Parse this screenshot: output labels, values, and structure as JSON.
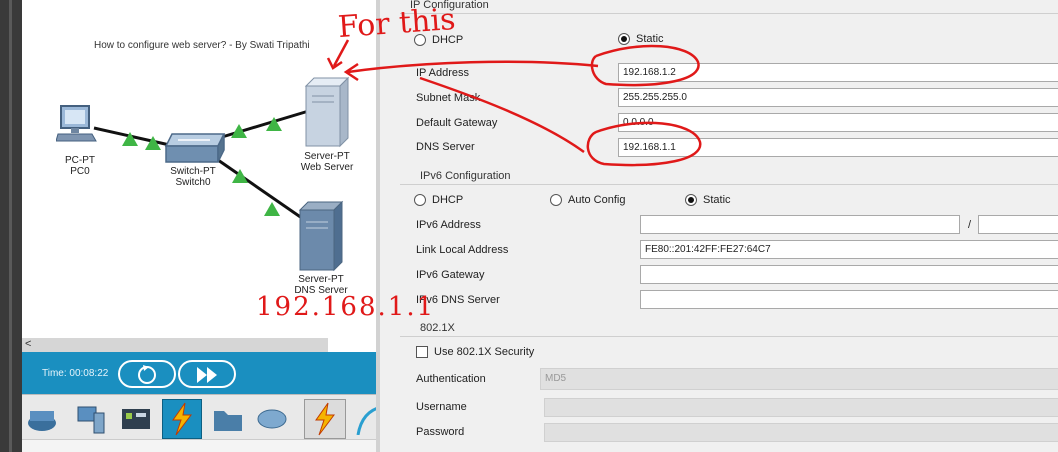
{
  "workspace": {
    "title": "How to configure web server? - By Swati Tripathi",
    "devices": {
      "pc": {
        "label_line1": "PC-PT",
        "label_line2": "PC0"
      },
      "switch": {
        "label_line1": "Switch-PT",
        "label_line2": "Switch0"
      },
      "web_server": {
        "label_line1": "Server-PT",
        "label_line2": "Web Server"
      },
      "dns_server": {
        "label_line1": "Server-PT",
        "label_line2": "DNS Server"
      }
    },
    "scroll_arrow": "<"
  },
  "timebar": {
    "time": "Time: 00:08:22",
    "cycle_icon": "cycle-devices-icon",
    "fast_forward_icon": "fast-forward-icon"
  },
  "device_palette": [
    "network-devices-icon",
    "end-devices-icon",
    "components-icon",
    "connections-icon",
    "miscellaneous-icon",
    "multiuser-icon",
    "lightning-icon",
    "wire-icon"
  ],
  "ip_config": {
    "title": "IP Configuration",
    "dhcp_label": "DHCP",
    "static_label": "Static",
    "mode": "Static",
    "ip_address_label": "IP Address",
    "ip_address": "192.168.1.2",
    "subnet_mask_label": "Subnet Mask",
    "subnet_mask": "255.255.255.0",
    "default_gateway_label": "Default Gateway",
    "default_gateway": "0.0.0.0",
    "dns_server_label": "DNS Server",
    "dns_server": "192.168.1.1"
  },
  "ipv6_config": {
    "title": "IPv6 Configuration",
    "dhcp_label": "DHCP",
    "auto_config_label": "Auto Config",
    "static_label": "Static",
    "mode": "Static",
    "ipv6_address_label": "IPv6 Address",
    "ipv6_address": "",
    "prefix_separator": "/",
    "prefix_length": "",
    "link_local_label": "Link Local Address",
    "link_local": "FE80::201:42FF:FE27:64C7",
    "ipv6_gateway_label": "IPv6 Gateway",
    "ipv6_gateway": "",
    "ipv6_dns_label": "IPv6 DNS Server",
    "ipv6_dns": ""
  },
  "dot1x": {
    "title": "802.1X",
    "use_security_label": "Use 802.1X Security",
    "use_security": false,
    "authentication_label": "Authentication",
    "authentication": "MD5",
    "username_label": "Username",
    "username": "",
    "password_label": "Password",
    "password": ""
  },
  "annotations": {
    "for_this": "For this",
    "dns_ip_handwritten": "192.168.1.1",
    "color": "#e01919"
  }
}
